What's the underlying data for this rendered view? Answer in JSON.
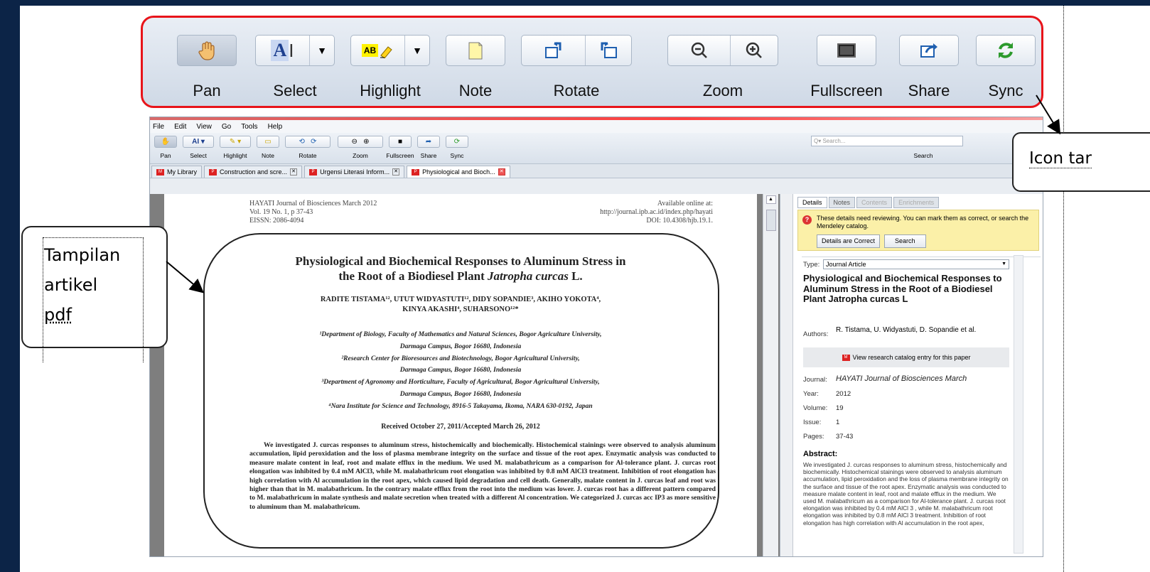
{
  "toolbar": {
    "pan": "Pan",
    "select": "Select",
    "highlight": "Highlight",
    "note": "Note",
    "rotate": "Rotate",
    "zoom": "Zoom",
    "fullscreen": "Fullscreen",
    "share": "Share",
    "sync": "Sync",
    "highlight_glyph": "AB"
  },
  "app": {
    "menu": [
      "File",
      "Edit",
      "View",
      "Go",
      "Tools",
      "Help"
    ],
    "small_toolbar": {
      "pan": "Pan",
      "select": "Select",
      "highlight": "Highlight",
      "note": "Note",
      "rotate": "Rotate",
      "zoom": "Zoom",
      "fullscreen": "Fullscreen",
      "share": "Share",
      "sync": "Sync",
      "search_placeholder": "Q▾ Search...",
      "search_label": "Search"
    },
    "tabs": [
      "My Library",
      "Construction and scre...",
      "Urgensi Literasi Inform...",
      "Physiological and Bioch..."
    ]
  },
  "pdf": {
    "journal_line1": "HAYATI Journal of Biosciences March 2012",
    "journal_line2": "Vol. 19 No. 1, p 37-43",
    "journal_line3": "EISSN: 2086-4094",
    "avail_line1": "Available online at:",
    "avail_line2": "http://journal.ipb.ac.id/index.php/hayati",
    "avail_line3": "DOI: 10.4308/hjb.19.1.",
    "title_line1": "Physiological and Biochemical Responses to Aluminum Stress in",
    "title_line2a": "the Root of a Biodiesel Plant ",
    "title_line2b": "Jatropha curcas",
    "title_line2c": " L.",
    "authors_line1": "RADITE TISTAMA¹², UTUT WIDYASTUTI¹², DIDY SOPANDIE³, AKIHO YOKOTA⁴,",
    "authors_line2": "KINYA AKASHI⁴, SUHARSONO¹²*",
    "aff1": "¹Department of Biology, Faculty of Mathematics and Natural Sciences, Bogor Agriculture University,",
    "aff1b": "Darmaga Campus, Bogor 16680, Indonesia",
    "aff2": "²Research Center for Bioresources and Biotechnology, Bogor Agricultural University,",
    "aff2b": "Darmaga Campus, Bogor 16680, Indonesia",
    "aff3": "³Department of Agronomy and Horticulture, Faculty of Agricultural, Bogor Agricultural University,",
    "aff3b": "Darmaga Campus, Bogor 16680, Indonesia",
    "aff4": "⁴Nara Institute for Science and Technology, 8916-5 Takayama, Ikoma, NARA 630-0192, Japan",
    "received": "Received October 27, 2011/Accepted March 26, 2012",
    "abstract": "We investigated J. curcas responses to aluminum stress, histochemically and biochemically. Histochemical stainings were observed to analysis aluminum accumulation, lipid peroxidation and the loss of plasma membrane integrity on the surface and tissue of the root apex. Enzymatic analysis was conducted to measure malate content in leaf, root and malate efflux in the medium. We used M. malabathricum as a comparison for Al-tolerance plant. J. curcas root elongation was inhibited by 0.4 mM AlCl3, while M. malabathricum root elongation was inhibited by 0.8 mM AlCl3 treatment. Inhibition of root elongation has high correlation with Al accumulation in the root apex, which caused lipid degradation and cell death. Generally, malate content in J. curcas leaf and root was higher than that in M. malabathricum. In the contrary malate efflux from the root into the medium was lower. J. curcas root has a different pattern compared to M. malabathricum in malate synthesis and malate secretion when treated with a different Al concentration. We categorized J. curcas acc IP3 as more sensitive to aluminum than M. malabathricum."
  },
  "side": {
    "tabs": [
      "Details",
      "Notes",
      "Contents",
      "Enrichments"
    ],
    "notice_text": "These details need reviewing. You can mark them as correct, or search the Mendeley catalog.",
    "btn_correct": "Details are Correct",
    "btn_search": "Search",
    "type_label": "Type:",
    "type_value": "Journal Article",
    "title": "Physiological and Biochemical Responses to Aluminum Stress in the Root of a Biodiesel Plant Jatropha curcas L",
    "authors_label": "Authors:",
    "authors_value": "R. Tistama, U. Widyastuti, D. Sopandie et al.",
    "catalog_link": "View research catalog entry for this paper",
    "journal_label": "Journal:",
    "journal_value": "HAYATI Journal of Biosciences March",
    "year_label": "Year:",
    "year_value": "2012",
    "volume_label": "Volume:",
    "volume_value": "19",
    "issue_label": "Issue:",
    "issue_value": "1",
    "pages_label": "Pages:",
    "pages_value": "37-43",
    "abstract_heading": "Abstract:",
    "abstract_text": "We investigated J. curcas responses to aluminum stress, histochemically and biochemically. Histochemical stainings were observed to analysis aluminum accumulation, lipid peroxidation and the loss of plasma membrane integrity on the surface and tissue of the root apex. Enzymatic analysis was conducted to measure malate content in leaf, root and malate efflux in the medium. We used M. malabathricum as a comparison for Al-tolerance plant. J. curcas root elongation was inhibited by 0.4 mM AlCl 3 , while M. malabathricum root elongation was inhibited by 0.8 mM AlCl 3 treatment. Inhibition of root elongation has high correlation with Al accumulation in the root apex,"
  },
  "annotations": {
    "left_line1": "Tampilan",
    "left_line2": "artikel",
    "left_line3": "pdf",
    "right": "Icon tar"
  },
  "colors": {
    "frame_red": "#e8141a",
    "slide_bg": "#0c2447"
  }
}
